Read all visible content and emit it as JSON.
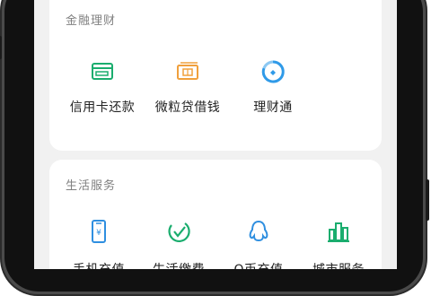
{
  "finance": {
    "title": "金融理财",
    "items": [
      {
        "label": "信用卡还款",
        "icon": "credit-card-icon",
        "color": "#1aad6e"
      },
      {
        "label": "微粒贷借钱",
        "icon": "money-bills-icon",
        "color": "#f0a03c"
      },
      {
        "label": "理财通",
        "icon": "wealth-drop-icon",
        "color": "#2f9ae8"
      }
    ]
  },
  "life": {
    "title": "生活服务",
    "items": [
      {
        "label": "手机充值",
        "icon": "mobile-phone-icon",
        "color": "#2f8fe0"
      },
      {
        "label": "生活缴费",
        "icon": "check-leaf-icon",
        "color": "#1aad6e"
      },
      {
        "label": "Q币充值",
        "icon": "penguin-icon",
        "color": "#2f8fe0"
      },
      {
        "label": "城市服务",
        "icon": "city-buildings-icon",
        "color": "#1aad6e"
      }
    ]
  }
}
